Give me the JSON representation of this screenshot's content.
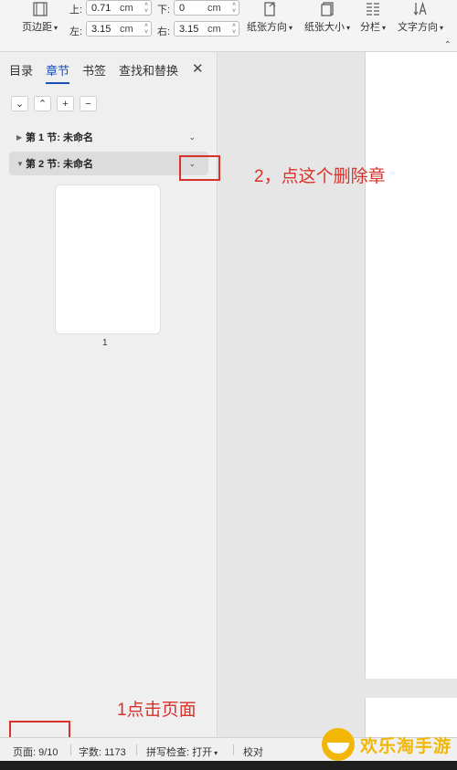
{
  "ribbon": {
    "page_margin_label": "页边距",
    "top_label": "上:",
    "top_value": "0.71",
    "bottom_label": "下:",
    "bottom_value": "0",
    "left_label": "左:",
    "left_value": "3.15",
    "right_label": "右:",
    "right_value": "3.15",
    "unit": "cm",
    "orientation_label": "纸张方向",
    "size_label": "纸张大小",
    "columns_label": "分栏",
    "text_direction_label": "文字方向"
  },
  "panel": {
    "tabs": [
      "目录",
      "章节",
      "书签",
      "查找和替换"
    ],
    "active_tab": "章节",
    "sections": [
      {
        "label": "第 1 节: 未命名",
        "expanded": false
      },
      {
        "label": "第 2 节: 未命名",
        "expanded": true
      }
    ],
    "thumbnail_page": "1"
  },
  "annotations": {
    "step2": "2，点这个删除章",
    "step1": "1点击页面"
  },
  "status": {
    "page": "页面: 9/10",
    "words": "字数: 1173",
    "spell": "拼写检查: 打开",
    "proofread": "校对"
  },
  "watermark": {
    "text": "欢乐淘手游"
  },
  "colors": {
    "accent": "#1a4fb8",
    "annotation": "#d9312b",
    "watermark": "#f2b705"
  }
}
